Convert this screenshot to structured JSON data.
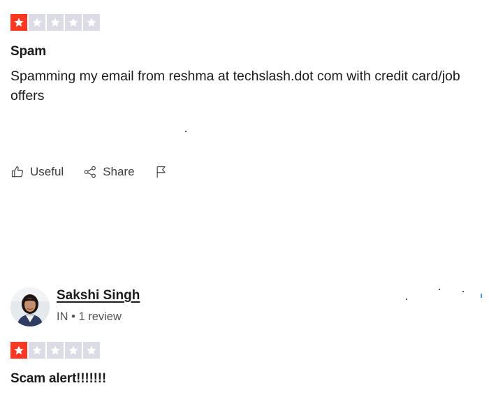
{
  "colors": {
    "star_filled": "#ff3722",
    "star_empty": "#dcdce6"
  },
  "review1": {
    "rating": 1,
    "rating_max": 5,
    "title": "Spam",
    "body": "Spamming my email from reshma at techslash.dot com with credit card/job offers",
    "actions": {
      "useful_label": "Useful",
      "useful_icon": "thumbs-up-icon",
      "share_label": "Share",
      "share_icon": "share-icon",
      "report_icon": "flag-icon"
    }
  },
  "review2": {
    "reviewer": {
      "name": "Sakshi Singh",
      "meta": "IN • 1 review",
      "avatar_icon": "avatar"
    },
    "rating": 1,
    "rating_max": 5,
    "title": "Scam alert!!!!!!!"
  }
}
